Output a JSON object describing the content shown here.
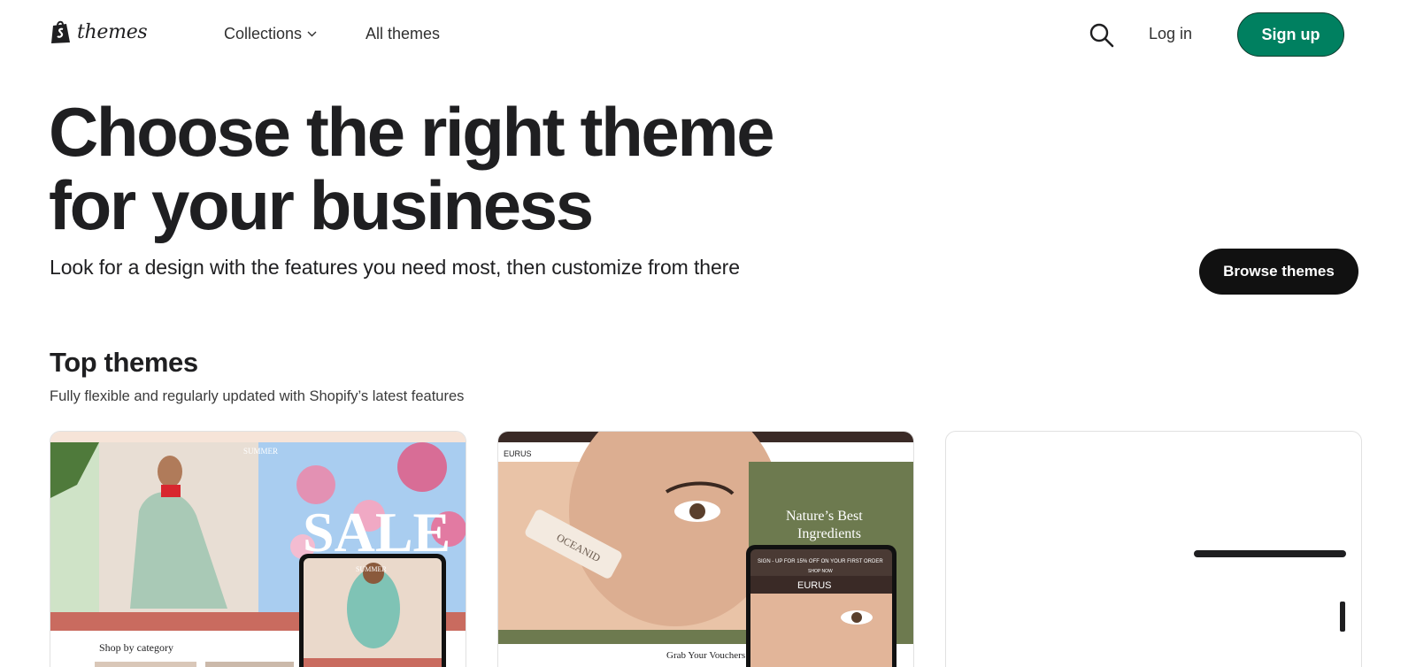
{
  "header": {
    "logo_text": "themes",
    "nav": {
      "collections": "Collections",
      "all_themes": "All themes"
    },
    "login": "Log in",
    "signup": "Sign up"
  },
  "hero": {
    "title_line1": "Choose the right theme",
    "title_line2": "for your business",
    "subtitle": "Look for a design with the features you need most, then customize from there",
    "browse_button": "Browse themes"
  },
  "top_themes": {
    "title": "Top themes",
    "subtitle": "Fully flexible and regularly updated with Shopify’s latest features",
    "cards": [
      {
        "hero_text": "SALE",
        "banner_text": "SUMMER",
        "section_text": "Shop by category",
        "phone_banner": "SUMMER"
      },
      {
        "brand": "EURUS",
        "headline_line1": "Nature’s Best",
        "headline_line2": "Ingredients",
        "phone_promo": "SIGN - UP FOR 15% OFF ON YOUR FIRST ORDER",
        "phone_shop": "SHOP NOW",
        "phone_brand": "EURUS",
        "bottom_text_prefix": "Grab Your ",
        "bottom_text_link": "Vouchers",
        "product_label": "OCEANID"
      },
      {}
    ]
  },
  "colors": {
    "brand_green": "#008060",
    "dark_button": "#111111",
    "text_primary": "#1f1f21"
  }
}
